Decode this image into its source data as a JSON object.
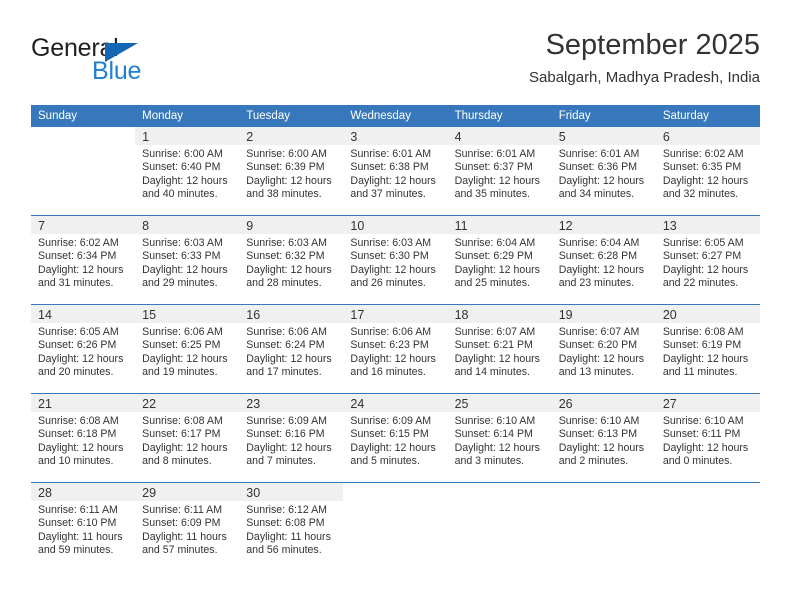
{
  "brand": {
    "name_top": "General",
    "name_bottom": "Blue",
    "triangle_color": "#1565b5",
    "blue_text_color": "#1f7fd0"
  },
  "header": {
    "title": "September 2025",
    "subtitle": "Sabalgarh, Madhya Pradesh, India",
    "accent_color": "#3778bc"
  },
  "calendar": {
    "weekday_headers": [
      "Sunday",
      "Monday",
      "Tuesday",
      "Wednesday",
      "Thursday",
      "Friday",
      "Saturday"
    ],
    "weeks": [
      [
        {
          "day": "",
          "sunrise": "",
          "sunset": "",
          "daylight1": "",
          "daylight2": ""
        },
        {
          "day": "1",
          "sunrise": "Sunrise: 6:00 AM",
          "sunset": "Sunset: 6:40 PM",
          "daylight1": "Daylight: 12 hours",
          "daylight2": "and 40 minutes."
        },
        {
          "day": "2",
          "sunrise": "Sunrise: 6:00 AM",
          "sunset": "Sunset: 6:39 PM",
          "daylight1": "Daylight: 12 hours",
          "daylight2": "and 38 minutes."
        },
        {
          "day": "3",
          "sunrise": "Sunrise: 6:01 AM",
          "sunset": "Sunset: 6:38 PM",
          "daylight1": "Daylight: 12 hours",
          "daylight2": "and 37 minutes."
        },
        {
          "day": "4",
          "sunrise": "Sunrise: 6:01 AM",
          "sunset": "Sunset: 6:37 PM",
          "daylight1": "Daylight: 12 hours",
          "daylight2": "and 35 minutes."
        },
        {
          "day": "5",
          "sunrise": "Sunrise: 6:01 AM",
          "sunset": "Sunset: 6:36 PM",
          "daylight1": "Daylight: 12 hours",
          "daylight2": "and 34 minutes."
        },
        {
          "day": "6",
          "sunrise": "Sunrise: 6:02 AM",
          "sunset": "Sunset: 6:35 PM",
          "daylight1": "Daylight: 12 hours",
          "daylight2": "and 32 minutes."
        }
      ],
      [
        {
          "day": "7",
          "sunrise": "Sunrise: 6:02 AM",
          "sunset": "Sunset: 6:34 PM",
          "daylight1": "Daylight: 12 hours",
          "daylight2": "and 31 minutes."
        },
        {
          "day": "8",
          "sunrise": "Sunrise: 6:03 AM",
          "sunset": "Sunset: 6:33 PM",
          "daylight1": "Daylight: 12 hours",
          "daylight2": "and 29 minutes."
        },
        {
          "day": "9",
          "sunrise": "Sunrise: 6:03 AM",
          "sunset": "Sunset: 6:32 PM",
          "daylight1": "Daylight: 12 hours",
          "daylight2": "and 28 minutes."
        },
        {
          "day": "10",
          "sunrise": "Sunrise: 6:03 AM",
          "sunset": "Sunset: 6:30 PM",
          "daylight1": "Daylight: 12 hours",
          "daylight2": "and 26 minutes."
        },
        {
          "day": "11",
          "sunrise": "Sunrise: 6:04 AM",
          "sunset": "Sunset: 6:29 PM",
          "daylight1": "Daylight: 12 hours",
          "daylight2": "and 25 minutes."
        },
        {
          "day": "12",
          "sunrise": "Sunrise: 6:04 AM",
          "sunset": "Sunset: 6:28 PM",
          "daylight1": "Daylight: 12 hours",
          "daylight2": "and 23 minutes."
        },
        {
          "day": "13",
          "sunrise": "Sunrise: 6:05 AM",
          "sunset": "Sunset: 6:27 PM",
          "daylight1": "Daylight: 12 hours",
          "daylight2": "and 22 minutes."
        }
      ],
      [
        {
          "day": "14",
          "sunrise": "Sunrise: 6:05 AM",
          "sunset": "Sunset: 6:26 PM",
          "daylight1": "Daylight: 12 hours",
          "daylight2": "and 20 minutes."
        },
        {
          "day": "15",
          "sunrise": "Sunrise: 6:06 AM",
          "sunset": "Sunset: 6:25 PM",
          "daylight1": "Daylight: 12 hours",
          "daylight2": "and 19 minutes."
        },
        {
          "day": "16",
          "sunrise": "Sunrise: 6:06 AM",
          "sunset": "Sunset: 6:24 PM",
          "daylight1": "Daylight: 12 hours",
          "daylight2": "and 17 minutes."
        },
        {
          "day": "17",
          "sunrise": "Sunrise: 6:06 AM",
          "sunset": "Sunset: 6:23 PM",
          "daylight1": "Daylight: 12 hours",
          "daylight2": "and 16 minutes."
        },
        {
          "day": "18",
          "sunrise": "Sunrise: 6:07 AM",
          "sunset": "Sunset: 6:21 PM",
          "daylight1": "Daylight: 12 hours",
          "daylight2": "and 14 minutes."
        },
        {
          "day": "19",
          "sunrise": "Sunrise: 6:07 AM",
          "sunset": "Sunset: 6:20 PM",
          "daylight1": "Daylight: 12 hours",
          "daylight2": "and 13 minutes."
        },
        {
          "day": "20",
          "sunrise": "Sunrise: 6:08 AM",
          "sunset": "Sunset: 6:19 PM",
          "daylight1": "Daylight: 12 hours",
          "daylight2": "and 11 minutes."
        }
      ],
      [
        {
          "day": "21",
          "sunrise": "Sunrise: 6:08 AM",
          "sunset": "Sunset: 6:18 PM",
          "daylight1": "Daylight: 12 hours",
          "daylight2": "and 10 minutes."
        },
        {
          "day": "22",
          "sunrise": "Sunrise: 6:08 AM",
          "sunset": "Sunset: 6:17 PM",
          "daylight1": "Daylight: 12 hours",
          "daylight2": "and 8 minutes."
        },
        {
          "day": "23",
          "sunrise": "Sunrise: 6:09 AM",
          "sunset": "Sunset: 6:16 PM",
          "daylight1": "Daylight: 12 hours",
          "daylight2": "and 7 minutes."
        },
        {
          "day": "24",
          "sunrise": "Sunrise: 6:09 AM",
          "sunset": "Sunset: 6:15 PM",
          "daylight1": "Daylight: 12 hours",
          "daylight2": "and 5 minutes."
        },
        {
          "day": "25",
          "sunrise": "Sunrise: 6:10 AM",
          "sunset": "Sunset: 6:14 PM",
          "daylight1": "Daylight: 12 hours",
          "daylight2": "and 3 minutes."
        },
        {
          "day": "26",
          "sunrise": "Sunrise: 6:10 AM",
          "sunset": "Sunset: 6:13 PM",
          "daylight1": "Daylight: 12 hours",
          "daylight2": "and 2 minutes."
        },
        {
          "day": "27",
          "sunrise": "Sunrise: 6:10 AM",
          "sunset": "Sunset: 6:11 PM",
          "daylight1": "Daylight: 12 hours",
          "daylight2": "and 0 minutes."
        }
      ],
      [
        {
          "day": "28",
          "sunrise": "Sunrise: 6:11 AM",
          "sunset": "Sunset: 6:10 PM",
          "daylight1": "Daylight: 11 hours",
          "daylight2": "and 59 minutes."
        },
        {
          "day": "29",
          "sunrise": "Sunrise: 6:11 AM",
          "sunset": "Sunset: 6:09 PM",
          "daylight1": "Daylight: 11 hours",
          "daylight2": "and 57 minutes."
        },
        {
          "day": "30",
          "sunrise": "Sunrise: 6:12 AM",
          "sunset": "Sunset: 6:08 PM",
          "daylight1": "Daylight: 11 hours",
          "daylight2": "and 56 minutes."
        },
        {
          "day": "",
          "sunrise": "",
          "sunset": "",
          "daylight1": "",
          "daylight2": ""
        },
        {
          "day": "",
          "sunrise": "",
          "sunset": "",
          "daylight1": "",
          "daylight2": ""
        },
        {
          "day": "",
          "sunrise": "",
          "sunset": "",
          "daylight1": "",
          "daylight2": ""
        },
        {
          "day": "",
          "sunrise": "",
          "sunset": "",
          "daylight1": "",
          "daylight2": ""
        }
      ]
    ]
  }
}
